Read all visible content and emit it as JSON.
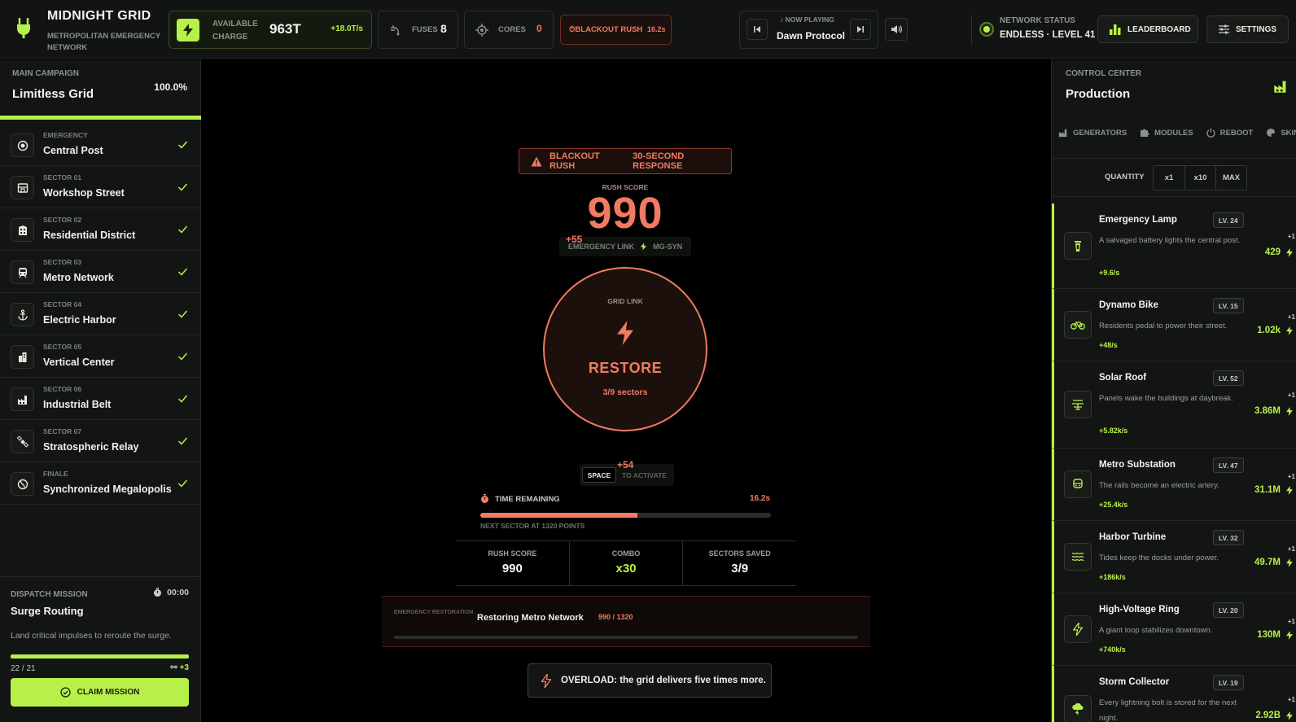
{
  "colors": {
    "accent": "#b8f04a",
    "alert": "#f27a63",
    "background": "#000000",
    "panel": "#121513"
  },
  "brand": {
    "title": "MIDNIGHT GRID",
    "subtitle": "METROPOLITAN EMERGENCY NETWORK",
    "icon": "plug-icon"
  },
  "topbar": {
    "charge_label": "AVAILABLE CHARGE",
    "charge_value": "963T",
    "charge_rate": "+18.0T/s",
    "fuses_label": "FUSES",
    "fuses_value": "8",
    "cores_label": "CORES",
    "cores_value": "0",
    "rush_label": "BLACKOUT RUSH",
    "rush_time": "16.2s",
    "now_playing_label": "NOW PLAYING",
    "now_playing_title": "Dawn Protocol",
    "network_label": "NETWORK STATUS",
    "network_value": "ENDLESS · LEVEL 41",
    "leaderboard_label": "LEADERBOARD",
    "settings_label": "SETTINGS"
  },
  "campaign": {
    "label": "MAIN CAMPAIGN",
    "title": "Limitless Grid",
    "progress_text": "100.0%",
    "progress": 1.0,
    "sectors": [
      {
        "tag": "EMERGENCY",
        "name": "Central Post",
        "icon": "target-icon",
        "done": true
      },
      {
        "tag": "SECTOR 01",
        "name": "Workshop Street",
        "icon": "storefront-icon",
        "done": true
      },
      {
        "tag": "SECTOR 02",
        "name": "Residential District",
        "icon": "building-icon",
        "done": true
      },
      {
        "tag": "SECTOR 03",
        "name": "Metro Network",
        "icon": "train-icon",
        "done": true
      },
      {
        "tag": "SECTOR 04",
        "name": "Electric Harbor",
        "icon": "anchor-icon",
        "done": true
      },
      {
        "tag": "SECTOR 05",
        "name": "Vertical Center",
        "icon": "skyscraper-icon",
        "done": true
      },
      {
        "tag": "SECTOR 06",
        "name": "Industrial Belt",
        "icon": "factory-icon",
        "done": true
      },
      {
        "tag": "SECTOR 07",
        "name": "Stratospheric Relay",
        "icon": "satellite-icon",
        "done": true
      },
      {
        "tag": "FINALE",
        "name": "Synchronized Megalopolis",
        "icon": "globe-icon",
        "done": true
      }
    ]
  },
  "dispatch": {
    "label": "DISPATCH MISSION",
    "timer": "00:00",
    "title": "Surge Routing",
    "description": "Land critical impulses to reroute the surge.",
    "progress_text": "22 / 21",
    "progress": 1.0,
    "reward": "+3",
    "claim_label": "CLAIM MISSION"
  },
  "rush": {
    "banner_title": "BLACKOUT RUSH",
    "banner_sub": "30-SECOND RESPONSE",
    "score_label": "RUSH SCORE",
    "score": "990",
    "link_text": "EMERGENCY LINK",
    "link_code": "MG-SYN",
    "float_a": "+55",
    "float_b": "+54",
    "circle_label": "GRID LINK",
    "action": "RESTORE",
    "sectors_text": "3/9 sectors",
    "key": "SPACE",
    "key_hint": "TO ACTIVATE",
    "time_label": "TIME REMAINING",
    "time_value": "16.2s",
    "time_fraction": 0.54,
    "next_sector": "NEXT SECTOR AT 1320 POINTS",
    "stats": [
      {
        "label": "RUSH SCORE",
        "value": "990"
      },
      {
        "label": "COMBO",
        "value": "x30"
      },
      {
        "label": "SECTORS SAVED",
        "value": "3/9"
      }
    ],
    "restoration_tag": "EMERGENCY RESTORATION",
    "restoration_title": "Restoring Metro Network",
    "restoration_progress": "990 / 1320",
    "overload_text": "OVERLOAD: the grid delivers five times more."
  },
  "control": {
    "label": "CONTROL CENTER",
    "title": "Production",
    "tabs": [
      "GENERATORS",
      "MODULES",
      "REBOOT",
      "SKINS"
    ],
    "quantity_label": "QUANTITY",
    "quantity_options": [
      "x1",
      "x10",
      "MAX"
    ],
    "generators": [
      {
        "name": "Emergency Lamp",
        "level": "LV. 24",
        "desc": "A salvaged battery lights the central post.",
        "rate": "+9.6/s",
        "cost": "429",
        "plus": "+1",
        "icon": "lantern-icon"
      },
      {
        "name": "Dynamo Bike",
        "level": "LV. 15",
        "desc": "Residents pedal to power their street.",
        "rate": "+48/s",
        "cost": "1.02k",
        "plus": "+1",
        "icon": "bike-icon"
      },
      {
        "name": "Solar Roof",
        "level": "LV. 52",
        "desc": "Panels wake the buildings at daybreak.",
        "rate": "+5.82k/s",
        "cost": "3.86M",
        "plus": "+1",
        "icon": "solar-panel-icon"
      },
      {
        "name": "Metro Substation",
        "level": "LV. 47",
        "desc": "The rails become an electric artery.",
        "rate": "+25.4k/s",
        "cost": "31.1M",
        "plus": "+1",
        "icon": "train-icon"
      },
      {
        "name": "Harbor Turbine",
        "level": "LV. 32",
        "desc": "Tides keep the docks under power.",
        "rate": "+186k/s",
        "cost": "49.7M",
        "plus": "+1",
        "icon": "waves-icon"
      },
      {
        "name": "High-Voltage Ring",
        "level": "LV. 20",
        "desc": "A giant loop stabilizes downtown.",
        "rate": "+740k/s",
        "cost": "130M",
        "plus": "+1",
        "icon": "bolt-icon"
      },
      {
        "name": "Storm Collector",
        "level": "LV. 19",
        "desc": "Every lightning bolt is stored for the next night.",
        "rate": "",
        "cost": "2.92B",
        "plus": "+1",
        "icon": "storm-cloud-icon"
      }
    ]
  }
}
